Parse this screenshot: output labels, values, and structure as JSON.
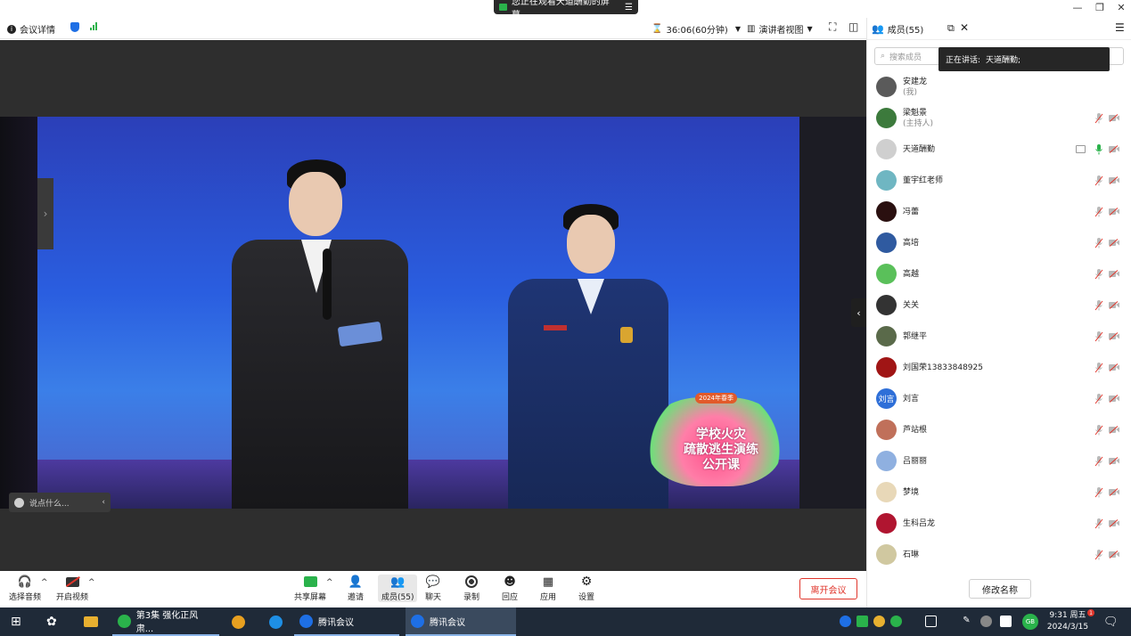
{
  "window": {
    "screen_banner": "您正在观看天道酬勤的屏幕",
    "minimize_glyph": "—",
    "restore_glyph": "❐",
    "close_glyph": "✕"
  },
  "toolbar": {
    "meeting_info": "会议详情",
    "timer": "36:06(60分钟)",
    "view_mode": "演讲者视图"
  },
  "video": {
    "banner_text": "学校火灾\n疏散逃生演练\n公开课",
    "banner_year": "2024年春季",
    "chat_placeholder": "说点什么..."
  },
  "controls": {
    "audio": "选择音频",
    "video": "开启视频",
    "share": "共享屏幕",
    "invite": "邀请",
    "members": "成员(55)",
    "chat": "聊天",
    "record": "录制",
    "react": "回应",
    "apps": "应用",
    "settings": "设置",
    "leave": "离开会议"
  },
  "panel": {
    "title": "成员(55)",
    "search_placeholder": "搜索成员",
    "speaking_label": "正在讲话:",
    "speaking_name": "天道酬勤;",
    "rename": "修改名称",
    "members": [
      {
        "name": "安建龙",
        "role": "(我)",
        "color": "#5a5a5a",
        "mic": false,
        "cam": false,
        "screen": false
      },
      {
        "name": "梁魁景",
        "role": "(主持人)",
        "color": "#3c7a3c",
        "mic": true,
        "cam": true,
        "screen": false
      },
      {
        "name": "天道酬勤",
        "role": "",
        "color": "#cfcfcf",
        "mic": true,
        "cam": true,
        "screen": true,
        "speaking": true
      },
      {
        "name": "董宇红老师",
        "role": "",
        "color": "#6fb6c2",
        "mic": true,
        "cam": true,
        "screen": false
      },
      {
        "name": "冯蕾",
        "role": "",
        "color": "#2a1010",
        "mic": true,
        "cam": true,
        "screen": false
      },
      {
        "name": "高培",
        "role": "",
        "color": "#2f5aa0",
        "mic": true,
        "cam": true,
        "screen": false
      },
      {
        "name": "高越",
        "role": "",
        "color": "#5ac05a",
        "mic": true,
        "cam": true,
        "screen": false
      },
      {
        "name": "关关",
        "role": "",
        "color": "#333",
        "mic": true,
        "cam": true,
        "screen": false
      },
      {
        "name": "郭继平",
        "role": "",
        "color": "#5a6a4a",
        "mic": true,
        "cam": true,
        "screen": false
      },
      {
        "name": "刘国荣13833848925",
        "role": "",
        "color": "#a01515",
        "mic": true,
        "cam": true,
        "screen": false
      },
      {
        "name": "刘言",
        "role": "",
        "color": "#2e6fd8",
        "initials": "刘言",
        "mic": true,
        "cam": true,
        "screen": false
      },
      {
        "name": "芦站根",
        "role": "",
        "color": "#c0705a",
        "mic": true,
        "cam": true,
        "screen": false
      },
      {
        "name": "吕丽丽",
        "role": "",
        "color": "#8fb0e0",
        "mic": true,
        "cam": true,
        "screen": false
      },
      {
        "name": "梦境",
        "role": "",
        "color": "#e8d8b8",
        "mic": true,
        "cam": true,
        "screen": false
      },
      {
        "name": "生科吕龙",
        "role": "",
        "color": "#b01530",
        "mic": true,
        "cam": true,
        "screen": false
      },
      {
        "name": "石琳",
        "role": "",
        "color": "#d0c8a0",
        "mic": true,
        "cam": true,
        "screen": false
      }
    ]
  },
  "taskbar": {
    "tasks": [
      {
        "label": "第3集 强化正风肃...",
        "icon_color": "#2ab24b"
      },
      {
        "label": "",
        "icon_color": "#e8a020"
      },
      {
        "label": "",
        "icon_color": "#1e8fe5"
      },
      {
        "label": "腾讯会议",
        "icon_color": "#1e6fe5"
      },
      {
        "label": "腾讯会议",
        "icon_color": "#1e6fe5"
      }
    ],
    "time": "9:31 周五",
    "date": "2024/3/15",
    "notif_count": "1",
    "tray_badge": "GB"
  },
  "colors": {
    "accent_green": "#2ab24b",
    "accent_blue": "#1e6fe5",
    "leave_red": "#e0352b",
    "taskbar": "#1f2a38"
  }
}
